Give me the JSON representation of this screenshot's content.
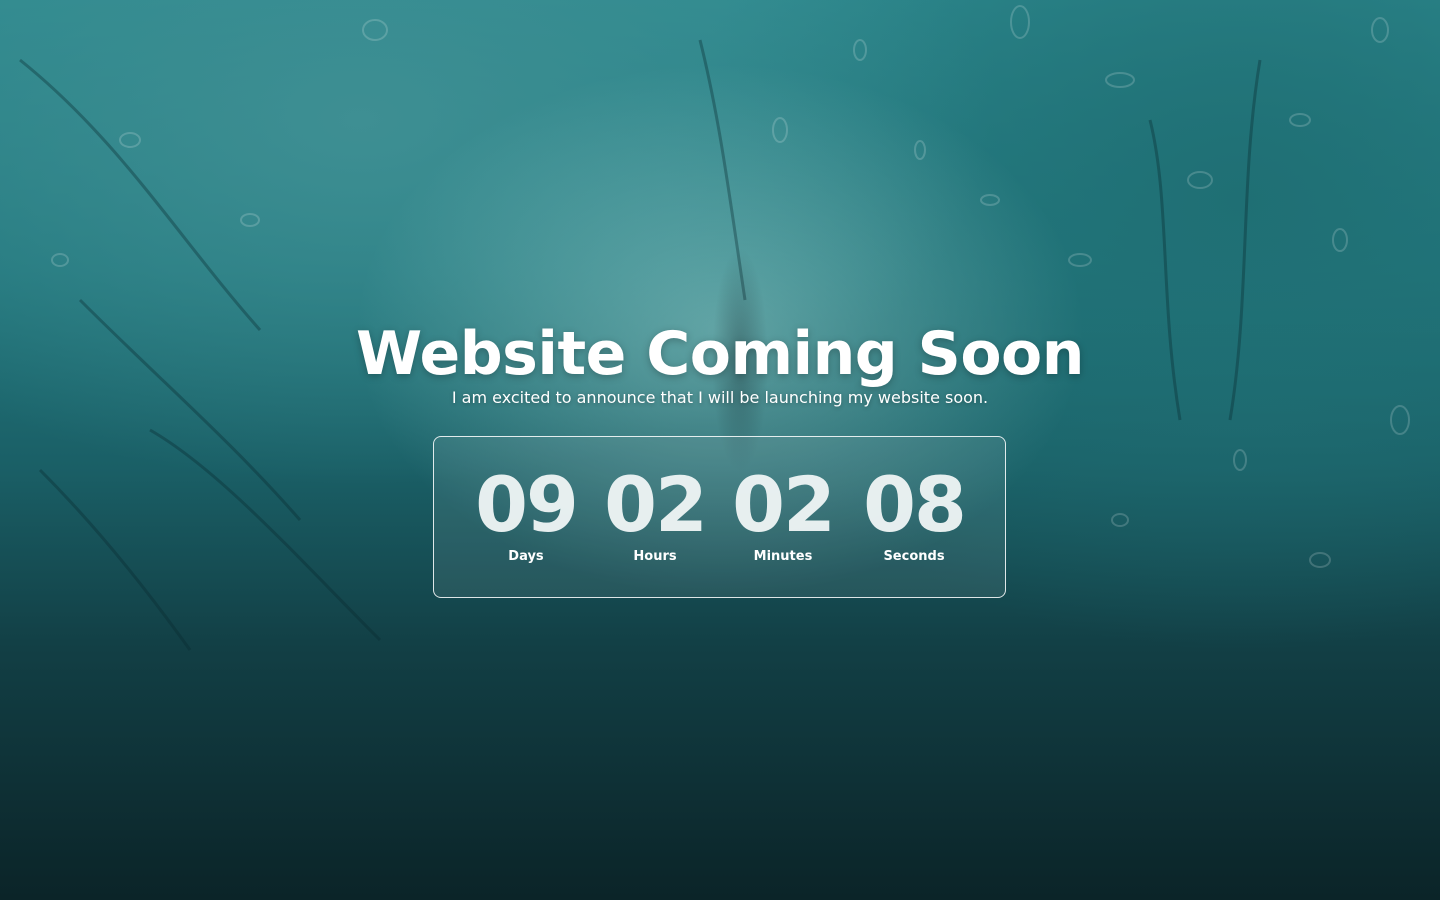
{
  "hero": {
    "title": "Website Coming Soon",
    "subtitle": "I am excited to announce that I will be launching my website soon."
  },
  "countdown": {
    "days": {
      "value": "09",
      "label": "Days"
    },
    "hours": {
      "value": "02",
      "label": "Hours"
    },
    "minutes": {
      "value": "02",
      "label": "Minutes"
    },
    "seconds": {
      "value": "08",
      "label": "Seconds"
    }
  },
  "background": {
    "description_icon": "rain-on-window-background",
    "accent_colors": [
      "#2e8a8f",
      "#0b2428",
      "#ff7a1e"
    ]
  }
}
